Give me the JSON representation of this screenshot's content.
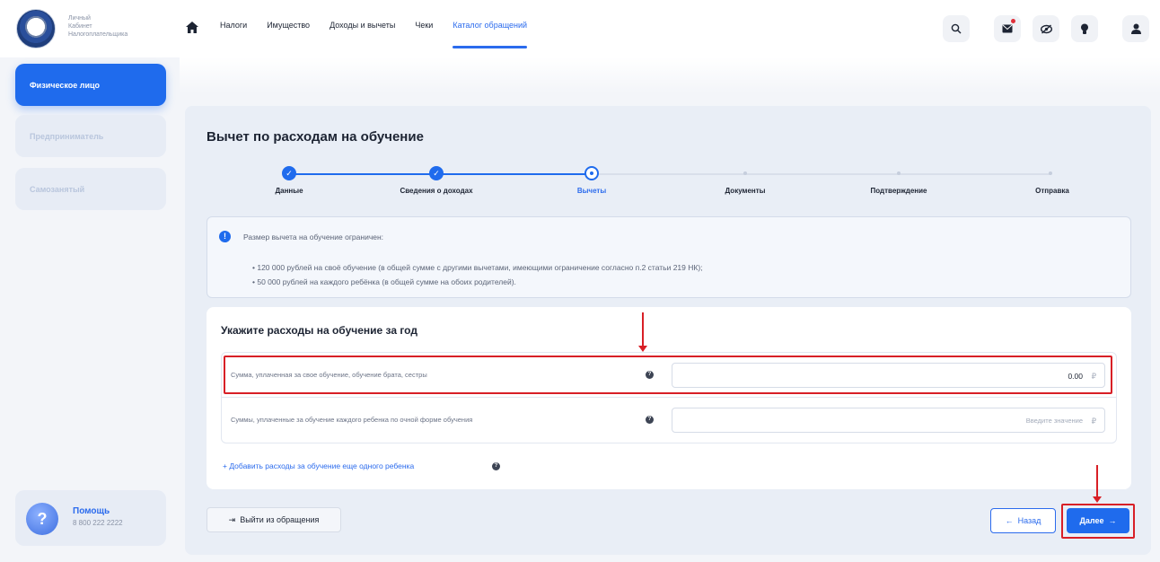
{
  "header": {
    "logo_text": [
      "Личный",
      "Кабинет",
      "Налогоплательщика"
    ],
    "nav": [
      {
        "label": "Налоги",
        "active": false
      },
      {
        "label": "Имущество",
        "active": false
      },
      {
        "label": "Доходы и вычеты",
        "active": false
      },
      {
        "label": "Чеки",
        "active": false
      },
      {
        "label": "Каталог обращений",
        "active": true
      }
    ],
    "icons": [
      "search-icon",
      "mail-icon",
      "eye-off-icon",
      "bulb-icon",
      "user-icon"
    ]
  },
  "sidebar": {
    "items": [
      {
        "label": "Физическое лицо",
        "active": true
      },
      {
        "label": "Предприниматель",
        "active": false
      },
      {
        "label": "Самозанятый",
        "active": false
      }
    ],
    "help": {
      "title": "Помощь",
      "phone": "8 800 222 2222"
    }
  },
  "page": {
    "title": "Вычет по расходам на обучение",
    "steps": [
      {
        "label": "Данные",
        "state": "done"
      },
      {
        "label": "Сведения о доходах",
        "state": "done"
      },
      {
        "label": "Вычеты",
        "state": "current"
      },
      {
        "label": "Документы",
        "state": "todo"
      },
      {
        "label": "Подтверждение",
        "state": "todo"
      },
      {
        "label": "Отправка",
        "state": "todo"
      }
    ],
    "info": {
      "title": "Размер вычета на обучение ограничен:",
      "bullets": [
        "• 120 000 рублей на своё обучение (в общей сумме с другими вычетами, имеющими ограничение согласно п.2 статьи 219 НК);",
        "• 50 000 рублей на каждого ребёнка (в общей сумме на обоих родителей)."
      ]
    },
    "form": {
      "title": "Укажите расходы на обучение за год",
      "rows": [
        {
          "label": "Сумма, уплаченная за свое обучение, обучение брата, сестры",
          "value": "0.00",
          "placeholder": "",
          "currency": "₽"
        },
        {
          "label": "Суммы, уплаченные за обучение каждого ребенка по очной форме обучения",
          "value": "",
          "placeholder": "Введите значение",
          "currency": "₽"
        }
      ],
      "add_link": "+  Добавить расходы за обучение еще одного ребенка"
    },
    "buttons": {
      "exit": "Выйти из обращения",
      "back": "Назад",
      "next": "Далее"
    }
  },
  "colors": {
    "accent": "#1f6bed",
    "annotation": "#d81f26"
  }
}
